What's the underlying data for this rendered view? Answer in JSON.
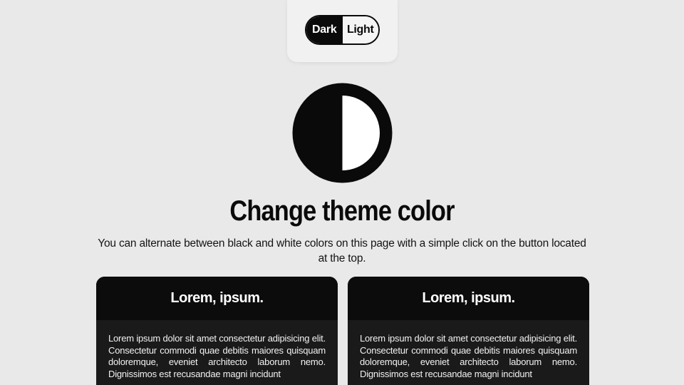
{
  "theme_toggle": {
    "dark_label": "Dark",
    "light_label": "Light",
    "selected": "Dark"
  },
  "hero": {
    "icon": "contrast-icon",
    "title": "Change theme color",
    "subtitle": "You can alternate between black and white colors on this page with a simple click on the button located at the top."
  },
  "cards": [
    {
      "title": "Lorem, ipsum.",
      "body": "Lorem ipsum dolor sit amet consectetur adipisicing elit. Consectetur commodi quae debitis maiores quisquam doloremque, eveniet architecto laborum nemo. Dignissimos est recusandae magni incidunt"
    },
    {
      "title": "Lorem, ipsum.",
      "body": "Lorem ipsum dolor sit amet consectetur adipisicing elit. Consectetur commodi quae debitis maiores quisquam doloremque, eveniet architecto laborum nemo. Dignissimos est recusandae magni incidunt"
    }
  ],
  "colors": {
    "background": "#e9e9e9",
    "dark": "#0a0a0a",
    "card": "#1a1a1a",
    "card_header": "#0c0c0c"
  }
}
